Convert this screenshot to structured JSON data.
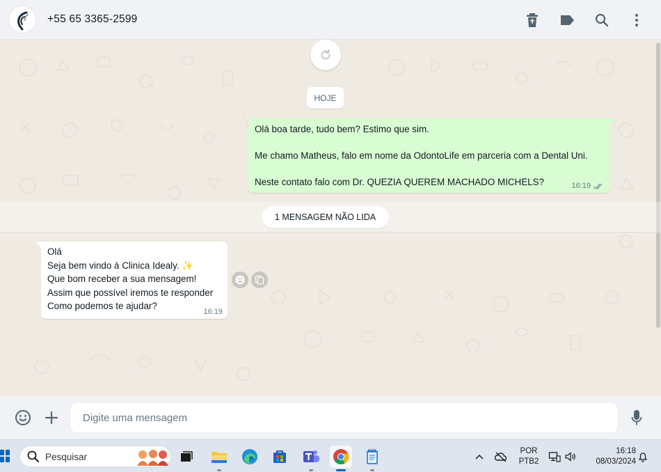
{
  "header": {
    "contact_name": "+55 65 3365-2599",
    "icons": [
      "delete-icon",
      "label-icon",
      "search-icon",
      "menu-icon"
    ]
  },
  "chat": {
    "date_chip": "HOJE",
    "outgoing": {
      "lines": [
        "Olá boa tarde, tudo bem? Estimo que sim.",
        "Me chamo Matheus, falo em nome da OdontoLife em parceria com a Dental Uni.",
        "Neste contato falo com Dr. QUEZIA QUEREM MACHADO MICHELS?"
      ],
      "time": "16:19",
      "status": "read"
    },
    "unread_label": "1 MENSAGEM NÃO LIDA",
    "incoming": {
      "lines": [
        "Olá",
        "Seja bem vindo à Clinica Idealy. ✨",
        "Que bom receber a sua mensagem!",
        "Assim que possível iremos te responder",
        "Como podemos te ajudar?"
      ],
      "time": "16:19"
    }
  },
  "composer": {
    "placeholder": "Digite uma mensagem"
  },
  "taskbar": {
    "search_label": "Pesquisar",
    "language_top": "POR",
    "language_bottom": "PTB2",
    "clock_time": "16:18",
    "clock_date": "08/03/2024"
  },
  "colors": {
    "outgoing_bubble": "#d9fdd3",
    "incoming_bubble": "#ffffff",
    "chat_background": "#efeae2",
    "header_background": "#f0f2f5",
    "read_ticks": "#53bdeb"
  }
}
